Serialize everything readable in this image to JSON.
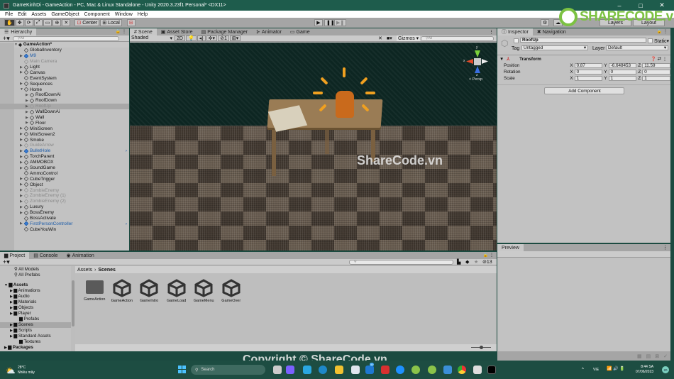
{
  "window": {
    "title": "GameKinhDi - GameAction - PC, Mac & Linux Standalone - Unity 2020.3.23f1 Personal* <DX11>",
    "controls": [
      "–",
      "□",
      "✕"
    ]
  },
  "menu": [
    "File",
    "Edit",
    "Assets",
    "GameObject",
    "Component",
    "Window",
    "Help"
  ],
  "toolbar": {
    "pivot_label": "Center",
    "space_label": "Local",
    "play": "▶",
    "pause": "❚❚",
    "step": "▶❚",
    "layers_label": "Layers",
    "layout_label": "Layout"
  },
  "hierarchy": {
    "tab": "Hierarchy",
    "search_placeholder": "All",
    "scene_name": "GameAction*",
    "items": [
      {
        "label": "GlobalInventory",
        "depth": 1,
        "arrow": false,
        "style": "normal"
      },
      {
        "label": "M9",
        "depth": 1,
        "arrow": true,
        "style": "blue"
      },
      {
        "label": "Main Camera",
        "depth": 1,
        "arrow": false,
        "style": "dim"
      },
      {
        "label": "Light",
        "depth": 1,
        "arrow": true,
        "style": "normal"
      },
      {
        "label": "Canvas",
        "depth": 1,
        "arrow": true,
        "style": "normal"
      },
      {
        "label": "EventSystem",
        "depth": 1,
        "arrow": false,
        "style": "normal"
      },
      {
        "label": "Sequences",
        "depth": 1,
        "arrow": true,
        "style": "normal"
      },
      {
        "label": "Home",
        "depth": 1,
        "arrow": "open",
        "style": "normal"
      },
      {
        "label": "RoofDownAi",
        "depth": 2,
        "arrow": true,
        "style": "normal"
      },
      {
        "label": "RoofDown",
        "depth": 2,
        "arrow": true,
        "style": "normal"
      },
      {
        "label": "RoofUp",
        "depth": 2,
        "arrow": true,
        "style": "selected"
      },
      {
        "label": "WallDownAi",
        "depth": 2,
        "arrow": true,
        "style": "normal"
      },
      {
        "label": "Wall",
        "depth": 2,
        "arrow": true,
        "style": "normal"
      },
      {
        "label": "Floor",
        "depth": 2,
        "arrow": true,
        "style": "normal"
      },
      {
        "label": "MiniScreen",
        "depth": 1,
        "arrow": true,
        "style": "normal"
      },
      {
        "label": "MiniScreen2",
        "depth": 1,
        "arrow": true,
        "style": "normal"
      },
      {
        "label": "Smoke",
        "depth": 1,
        "arrow": true,
        "style": "normal"
      },
      {
        "label": "GuideArrow",
        "depth": 1,
        "arrow": true,
        "style": "dim"
      },
      {
        "label": "BulletHole",
        "depth": 1,
        "arrow": true,
        "style": "blue",
        "more": true
      },
      {
        "label": "TorchParent",
        "depth": 1,
        "arrow": true,
        "style": "normal"
      },
      {
        "label": "AMMOBOX",
        "depth": 1,
        "arrow": true,
        "style": "normal"
      },
      {
        "label": "SoundGame",
        "depth": 1,
        "arrow": true,
        "style": "normal"
      },
      {
        "label": "AmmoControl",
        "depth": 1,
        "arrow": false,
        "style": "normal"
      },
      {
        "label": "CubeTrigger",
        "depth": 1,
        "arrow": true,
        "style": "normal"
      },
      {
        "label": "Object",
        "depth": 1,
        "arrow": true,
        "style": "normal"
      },
      {
        "label": "ZombieEnemy",
        "depth": 1,
        "arrow": true,
        "style": "dim"
      },
      {
        "label": "ZombieEnemy (1)",
        "depth": 1,
        "arrow": true,
        "style": "dim"
      },
      {
        "label": "ZombieEnemy (2)",
        "depth": 1,
        "arrow": true,
        "style": "dim"
      },
      {
        "label": "Luxury",
        "depth": 1,
        "arrow": true,
        "style": "normal"
      },
      {
        "label": "BossEnemy",
        "depth": 1,
        "arrow": true,
        "style": "normal"
      },
      {
        "label": "BossActivate",
        "depth": 1,
        "arrow": false,
        "style": "normal"
      },
      {
        "label": "FirstPersonController",
        "depth": 1,
        "arrow": true,
        "style": "blue",
        "more": true
      },
      {
        "label": "CubeYouWin",
        "depth": 1,
        "arrow": false,
        "style": "normal"
      }
    ]
  },
  "scene_tabs": [
    "Scene",
    "Asset Store",
    "Package Manager",
    "Animator",
    "Game"
  ],
  "scene_bar": {
    "shading": "Shaded",
    "mode_2d": "2D",
    "hidden_count": "1",
    "gizmos": "Gizmos",
    "search_placeholder": "All",
    "persp_label": "< Persp",
    "axis": {
      "x": "x",
      "y": "y",
      "z": "z"
    }
  },
  "inspector": {
    "tabs": [
      "Inspector",
      "Navigation"
    ],
    "object_name": "RoofUp",
    "static_label": "Static",
    "tag_label": "Tag",
    "tag_value": "Untagged",
    "layer_label": "Layer",
    "layer_value": "Default",
    "component": "Transform",
    "rows": [
      {
        "label": "Position",
        "x": "0.87",
        "y": "-6.648453",
        "z": "11.59"
      },
      {
        "label": "Rotation",
        "x": "0",
        "y": "0",
        "z": "0"
      },
      {
        "label": "Scale",
        "x": "1",
        "y": "1",
        "z": "1"
      }
    ],
    "add_component": "Add Component",
    "preview_tab": "Preview"
  },
  "project": {
    "tabs": [
      "Project",
      "Console",
      "Animation"
    ],
    "favorites": [
      "All Models",
      "All Prefabs"
    ],
    "assets_root": "Assets",
    "folders": [
      "Animations",
      "Audio",
      "Materials",
      "Objects",
      "Player",
      "Prefabs",
      "Scenes",
      "Scripts",
      "Standard Assets",
      "Textures"
    ],
    "selected_folder": "Scenes",
    "packages": "Packages",
    "breadcrumb": [
      "Assets",
      "Scenes"
    ],
    "hidden_count": "13",
    "files": [
      {
        "name": "GameAction",
        "type": "folder"
      },
      {
        "name": "GameAction",
        "type": "scene"
      },
      {
        "name": "GameIntro",
        "type": "scene"
      },
      {
        "name": "GameLoad",
        "type": "scene"
      },
      {
        "name": "GameMenu",
        "type": "scene"
      },
      {
        "name": "GameOver",
        "type": "scene"
      }
    ]
  },
  "watermark": {
    "logo_text": "SHARECODE.vn",
    "center_text": "ShareCode.vn",
    "bottom_text": "Copyright © ShareCode.vn"
  },
  "taskbar": {
    "weather_temp": "28°C",
    "weather_desc": "Nhiều mây",
    "search_label": "Search",
    "mail_badge": "55",
    "lang": "VIE",
    "time": "8:44 SA",
    "date": "07/06/2023",
    "notif_badge": "20"
  }
}
